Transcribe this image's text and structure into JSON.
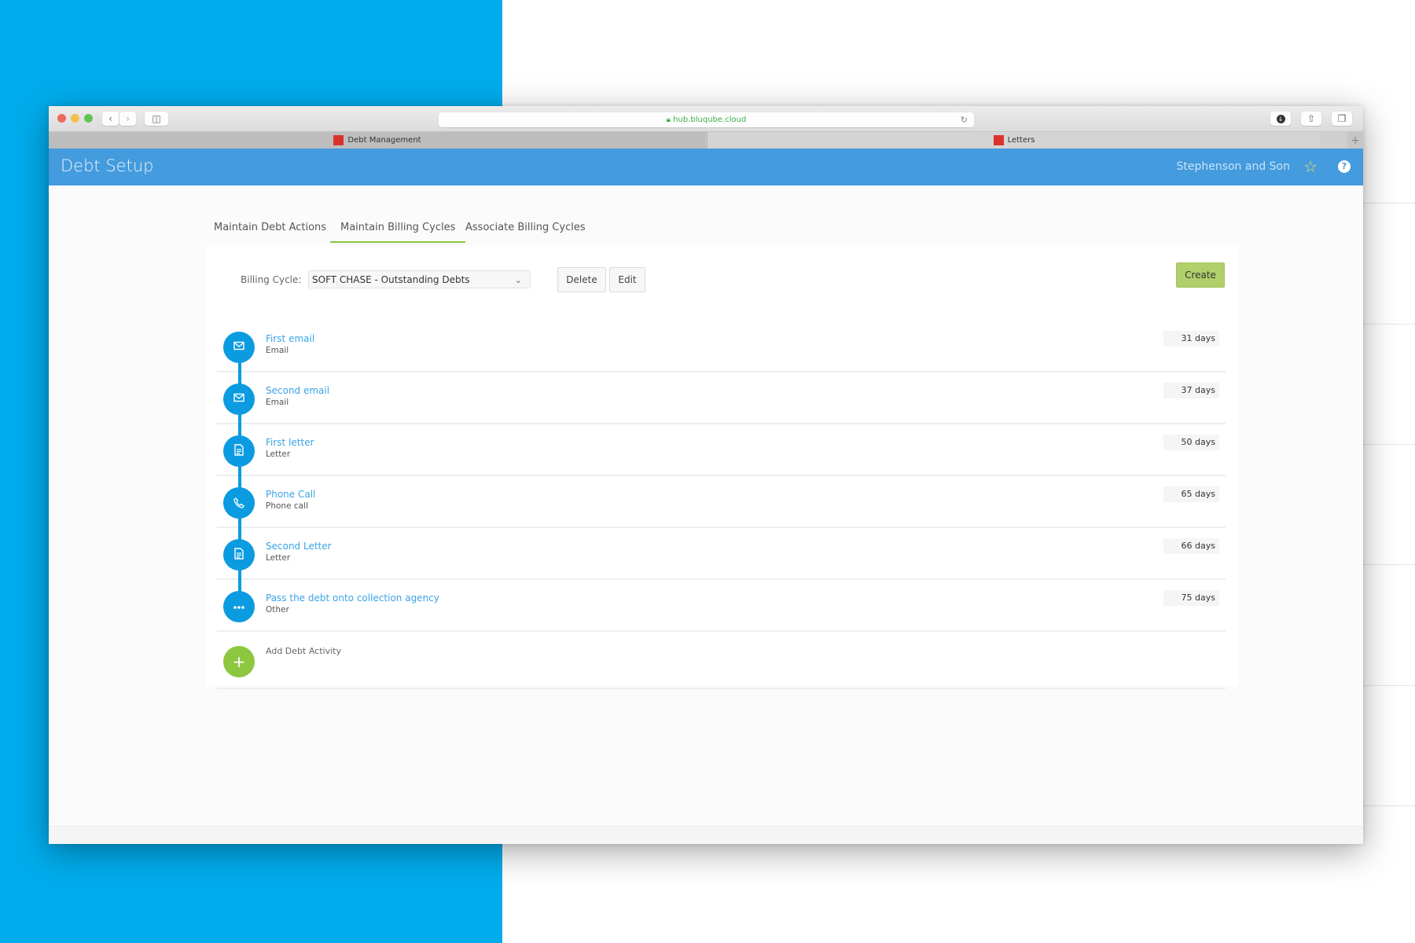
{
  "browser": {
    "url": "hub.bluqube.cloud",
    "tabs": [
      {
        "label": "Debt Management"
      },
      {
        "label": "Letters"
      }
    ],
    "new_tab": "+"
  },
  "header": {
    "title": "Debt Setup",
    "company": "Stephenson and Son",
    "favorite_icon": "☆",
    "help_icon": "?"
  },
  "page_tabs": [
    {
      "label": "Maintain Debt Actions",
      "active": false
    },
    {
      "label": "Maintain Billing Cycles",
      "active": true
    },
    {
      "label": "Associate Billing Cycles",
      "active": false
    }
  ],
  "billing": {
    "label": "Billing Cycle:",
    "selected": "SOFT CHASE - Outstanding Debts",
    "delete_label": "Delete",
    "edit_label": "Edit",
    "create_label": "Create"
  },
  "activities": [
    {
      "title": "First email",
      "type": "Email",
      "days": "31 days",
      "icon": "envelope-icon"
    },
    {
      "title": "Second email",
      "type": "Email",
      "days": "37 days",
      "icon": "envelope-icon"
    },
    {
      "title": "First letter",
      "type": "Letter",
      "days": "50 days",
      "icon": "document-icon"
    },
    {
      "title": "Phone Call",
      "type": "Phone call",
      "days": "65 days",
      "icon": "phone-icon"
    },
    {
      "title": "Second Letter",
      "type": "Letter",
      "days": "66 days",
      "icon": "document-icon"
    },
    {
      "title": "Pass the debt onto collection agency",
      "type": "Other",
      "days": "75 days",
      "icon": "ellipsis-icon"
    }
  ],
  "add_activity": {
    "label": "Add Debt Activity",
    "icon": "+"
  },
  "colors": {
    "brand_blue": "#449bdd",
    "timeline_blue": "#0b9be0",
    "accent_green": "#8cc63f",
    "create_green": "#b1cf6a",
    "background_blue": "#00acec"
  }
}
